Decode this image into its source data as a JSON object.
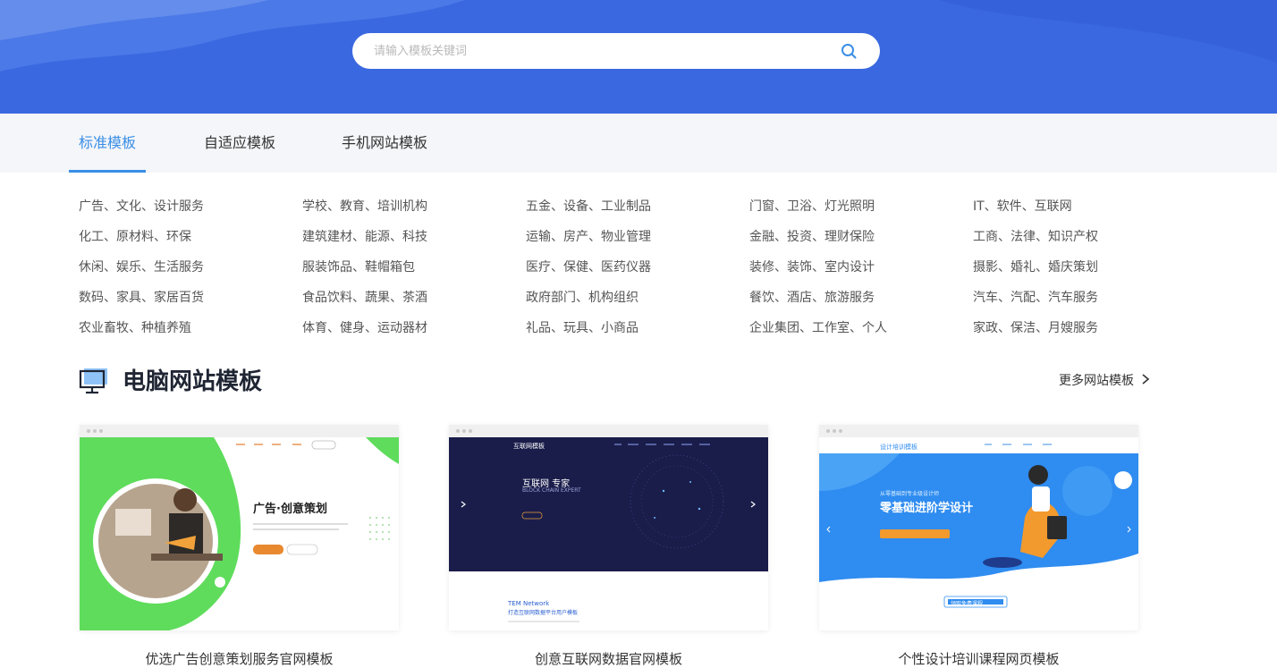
{
  "search": {
    "placeholder": "请输入模板关键词"
  },
  "tabs": [
    {
      "label": "标准模板",
      "active": true
    },
    {
      "label": "自适应模板",
      "active": false
    },
    {
      "label": "手机网站模板",
      "active": false
    }
  ],
  "categories": [
    [
      "广告、文化、设计服务",
      "学校、教育、培训机构",
      "五金、设备、工业制品",
      "门窗、卫浴、灯光照明",
      "IT、软件、互联网"
    ],
    [
      "化工、原材料、环保",
      "建筑建材、能源、科技",
      "运输、房产、物业管理",
      "金融、投资、理财保险",
      "工商、法律、知识产权"
    ],
    [
      "休闲、娱乐、生活服务",
      "服装饰品、鞋帽箱包",
      "医疗、保健、医药仪器",
      "装修、装饰、室内设计",
      "摄影、婚礼、婚庆策划"
    ],
    [
      "数码、家具、家居百货",
      "食品饮料、蔬果、茶酒",
      "政府部门、机构组织",
      "餐饮、酒店、旅游服务",
      "汽车、汽配、汽车服务"
    ],
    [
      "农业畜牧、种植养殖",
      "体育、健身、运动器材",
      "礼品、玩具、小商品",
      "企业集团、工作室、个人",
      "家政、保洁、月嫂服务"
    ]
  ],
  "section": {
    "title": "电脑网站模板",
    "more_label": "更多网站模板"
  },
  "cards": [
    {
      "title": "优选广告创意策划服务官网模板",
      "preview_heading": "广告·创意策划"
    },
    {
      "title": "创意互联网数据官网模板",
      "preview_logo": "互联网模板",
      "preview_heading": "互联网 专家",
      "preview_sub": "BLOCK CHAIN EXPERT",
      "preview_footer_title": "TEM Network",
      "preview_footer_sub": "打造互联网数据平台用户模板"
    },
    {
      "title": "个性设计培训课程网页模板",
      "preview_logo": "设计培训模板",
      "preview_small": "从零基础到专业级设计师",
      "preview_heading": "零基础进阶学设计",
      "preview_button": "领取免费课程"
    }
  ],
  "colors": {
    "hero_blue": "#3a68e0",
    "accent": "#3a8ee6",
    "tab_bg": "#f4f6f9",
    "card1_green": "#5fdc5c",
    "card2_navy": "#1a1d4a",
    "card3_blue": "#2f8cf0"
  }
}
